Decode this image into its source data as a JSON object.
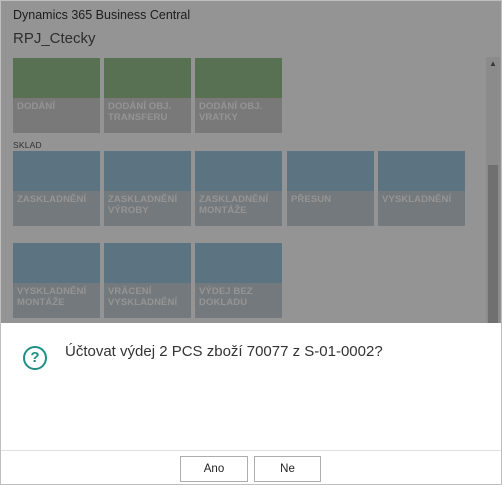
{
  "header": {
    "app_name": "Dynamics 365 Business Central",
    "page_title": "RPJ_Ctecky"
  },
  "groups": {
    "sklad_label": "SKLAD"
  },
  "tiles": {
    "dodani": "DODÁNÍ",
    "dodani_transfer": "DODÁNÍ OBJ. TRANSFERU",
    "dodani_vratky": "DODÁNÍ OBJ. VRATKY",
    "zaskladneni": "ZASKLADNĚNÍ",
    "zaskladneni_vyroby": "ZASKLADNĚNÍ VÝROBY",
    "zaskladneni_montaze": "ZASKLADNĚNÍ MONTÁŽE",
    "presun": "PŘESUN",
    "vyskladneni": "VYSKLADNĚNÍ",
    "vyskladneni_montaze": "VYSKLADNĚNÍ MONTÁŽE",
    "vraceni_vyskladneni": "VRÁCENÍ VYSKLADNĚNÍ",
    "vydej_bez_dokladu": "VÝDEJ BEZ DOKLADU"
  },
  "tile_colors": {
    "green": "#98c390",
    "blue": "#9fc8de"
  },
  "dialog": {
    "icon": "question-icon",
    "message": "Účtovat výdej 2 PCS zboží 70077 z S-01-0002?",
    "yes_label": "Ano",
    "no_label": "Ne",
    "accent_color": "#1f8f86"
  }
}
